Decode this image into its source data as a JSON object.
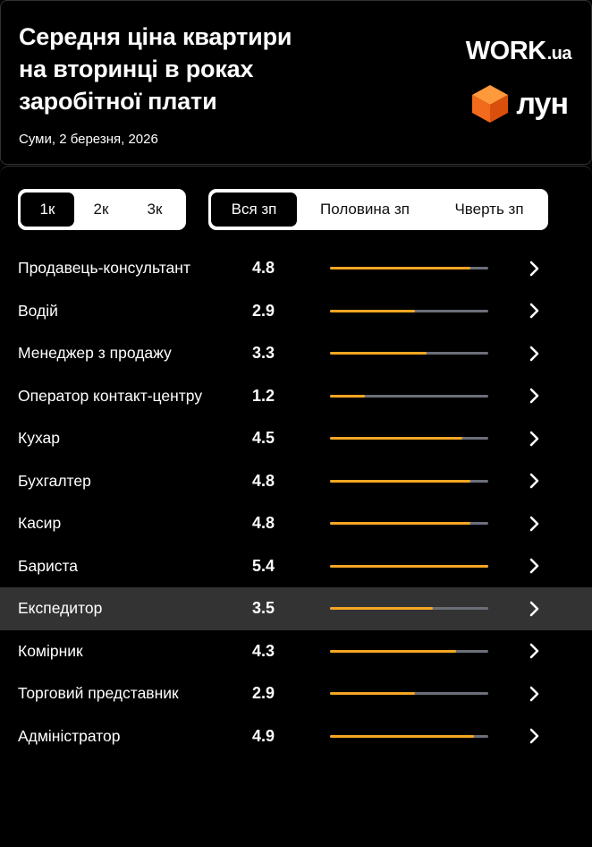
{
  "header": {
    "title_lines": [
      "Середня ціна квартири",
      "на вторинці в роках",
      "заробітної плати"
    ],
    "subtitle": "Суми, 2 березня, 2026",
    "logo_work_main": "WORK",
    "logo_work_suffix": ".ua",
    "logo_lun": "лун"
  },
  "colors": {
    "accent": "#f5a623",
    "track": "#6b6f78",
    "highlight_row": "#333333",
    "lun_cube": "#f26a1b"
  },
  "room_tabs": [
    {
      "label": "1к",
      "active": true
    },
    {
      "label": "2к",
      "active": false
    },
    {
      "label": "3к",
      "active": false
    }
  ],
  "salary_tabs": [
    {
      "label": "Вся зп",
      "active": true
    },
    {
      "label": "Половина зп",
      "active": false
    },
    {
      "label": "Чверть зп",
      "active": false
    }
  ],
  "scale_max": 5.4,
  "professions": [
    {
      "name": "Продавець-консультант",
      "value": "4.8",
      "highlighted": false
    },
    {
      "name": "Водій",
      "value": "2.9",
      "highlighted": false
    },
    {
      "name": "Менеджер з продажу",
      "value": "3.3",
      "highlighted": false
    },
    {
      "name": "Оператор контакт-центру",
      "value": "1.2",
      "highlighted": false
    },
    {
      "name": "Кухар",
      "value": "4.5",
      "highlighted": false
    },
    {
      "name": "Бухгалтер",
      "value": "4.8",
      "highlighted": false
    },
    {
      "name": "Касир",
      "value": "4.8",
      "highlighted": false
    },
    {
      "name": "Бариста",
      "value": "5.4",
      "highlighted": false
    },
    {
      "name": "Експедитор",
      "value": "3.5",
      "highlighted": true
    },
    {
      "name": "Комірник",
      "value": "4.3",
      "highlighted": false
    },
    {
      "name": "Торговий представник",
      "value": "2.9",
      "highlighted": false
    },
    {
      "name": "Адміністратор",
      "value": "4.9",
      "highlighted": false
    }
  ],
  "row_icon": "chevron-right-icon"
}
